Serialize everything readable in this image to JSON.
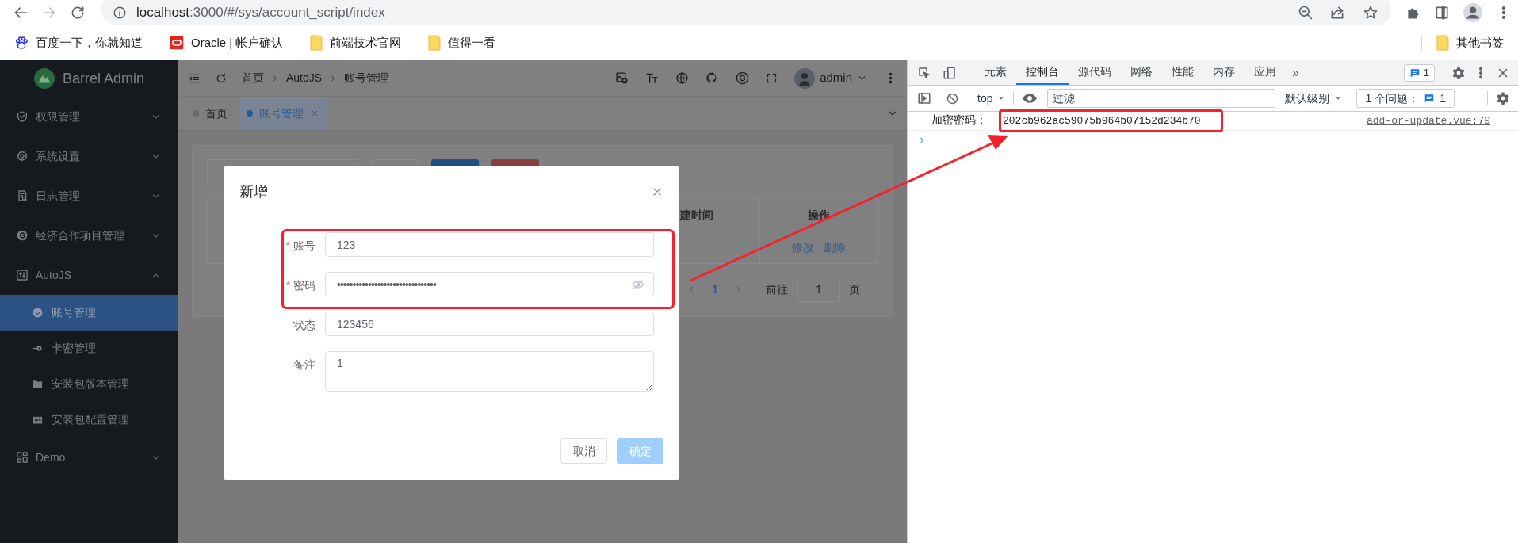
{
  "browser": {
    "forward_disabled": true,
    "url": {
      "host": "localhost",
      "path": ":3000/#/sys/account_script/index"
    },
    "bookmarks": [
      {
        "label": "百度一下，你就知道",
        "kind": "paw"
      },
      {
        "label": "Oracle | 帐户确认",
        "kind": "oracle"
      },
      {
        "label": "前端技术官网",
        "kind": "folder"
      },
      {
        "label": "值得一看",
        "kind": "folder"
      }
    ],
    "other_bookmarks": "其他书签"
  },
  "app": {
    "brand": "Barrel Admin",
    "menu": [
      {
        "label": "权限管理",
        "kind": "shield",
        "expanded": false
      },
      {
        "label": "系统设置",
        "kind": "gear",
        "expanded": false
      },
      {
        "label": "日志管理",
        "kind": "document",
        "expanded": false
      },
      {
        "label": "经济合作项目管理",
        "kind": "badge",
        "expanded": false
      },
      {
        "label": "AutoJS",
        "kind": "sliders",
        "expanded": true,
        "children": [
          {
            "label": "账号管理",
            "kind": "smile",
            "selected": true
          },
          {
            "label": "卡密管理",
            "kind": "key",
            "selected": false
          },
          {
            "label": "安装包版本管理",
            "kind": "folder",
            "selected": false
          },
          {
            "label": "安装包配置管理",
            "kind": "calendar",
            "selected": false
          }
        ]
      },
      {
        "label": "Demo",
        "kind": "grid",
        "expanded": false
      }
    ],
    "breadcrumb": [
      "首页",
      "AutoJS",
      "账号管理"
    ],
    "user": "admin",
    "tabs": [
      {
        "label": "首页",
        "selected": false
      },
      {
        "label": "账号管理",
        "selected": true
      }
    ],
    "table": {
      "columns": [
        "建时间",
        "操作"
      ],
      "row_actions": [
        "修改",
        "删除"
      ]
    },
    "pagination": {
      "current": "1",
      "goto_label": "前往",
      "goto_value": "1",
      "unit": "页"
    }
  },
  "dialog": {
    "title": "新增",
    "fields": [
      {
        "required_mark": "*",
        "label": "账号",
        "kind": "text",
        "value": "123"
      },
      {
        "required_mark": "*",
        "label": "密码",
        "kind": "password",
        "value": "••••••••••••••••••••••••••••••••"
      },
      {
        "label": "状态",
        "kind": "text",
        "value": "123456"
      },
      {
        "label": "备注",
        "kind": "textarea",
        "value": "1"
      }
    ],
    "buttons": [
      {
        "label": "取消",
        "kind": "default",
        "disabled": false
      },
      {
        "label": "确定",
        "kind": "primary",
        "disabled": true
      }
    ]
  },
  "devtools": {
    "tabs": [
      {
        "label": "元素",
        "selected": false
      },
      {
        "label": "控制台",
        "selected": true
      },
      {
        "label": "源代码",
        "selected": false
      },
      {
        "label": "网络",
        "selected": false
      },
      {
        "label": "性能",
        "selected": false
      },
      {
        "label": "内存",
        "selected": false
      },
      {
        "label": "应用",
        "selected": false
      }
    ],
    "more": "»",
    "message_count": "1",
    "context": "top",
    "filter_placeholder": "过滤",
    "level": "默认级别",
    "issues_label": "1 个问题：",
    "issues_count": "1",
    "console": [
      {
        "label": "加密密码：",
        "value": "202cb962ac59075b964b07152d234b70",
        "source": "add-or-update.vue:79"
      }
    ]
  }
}
